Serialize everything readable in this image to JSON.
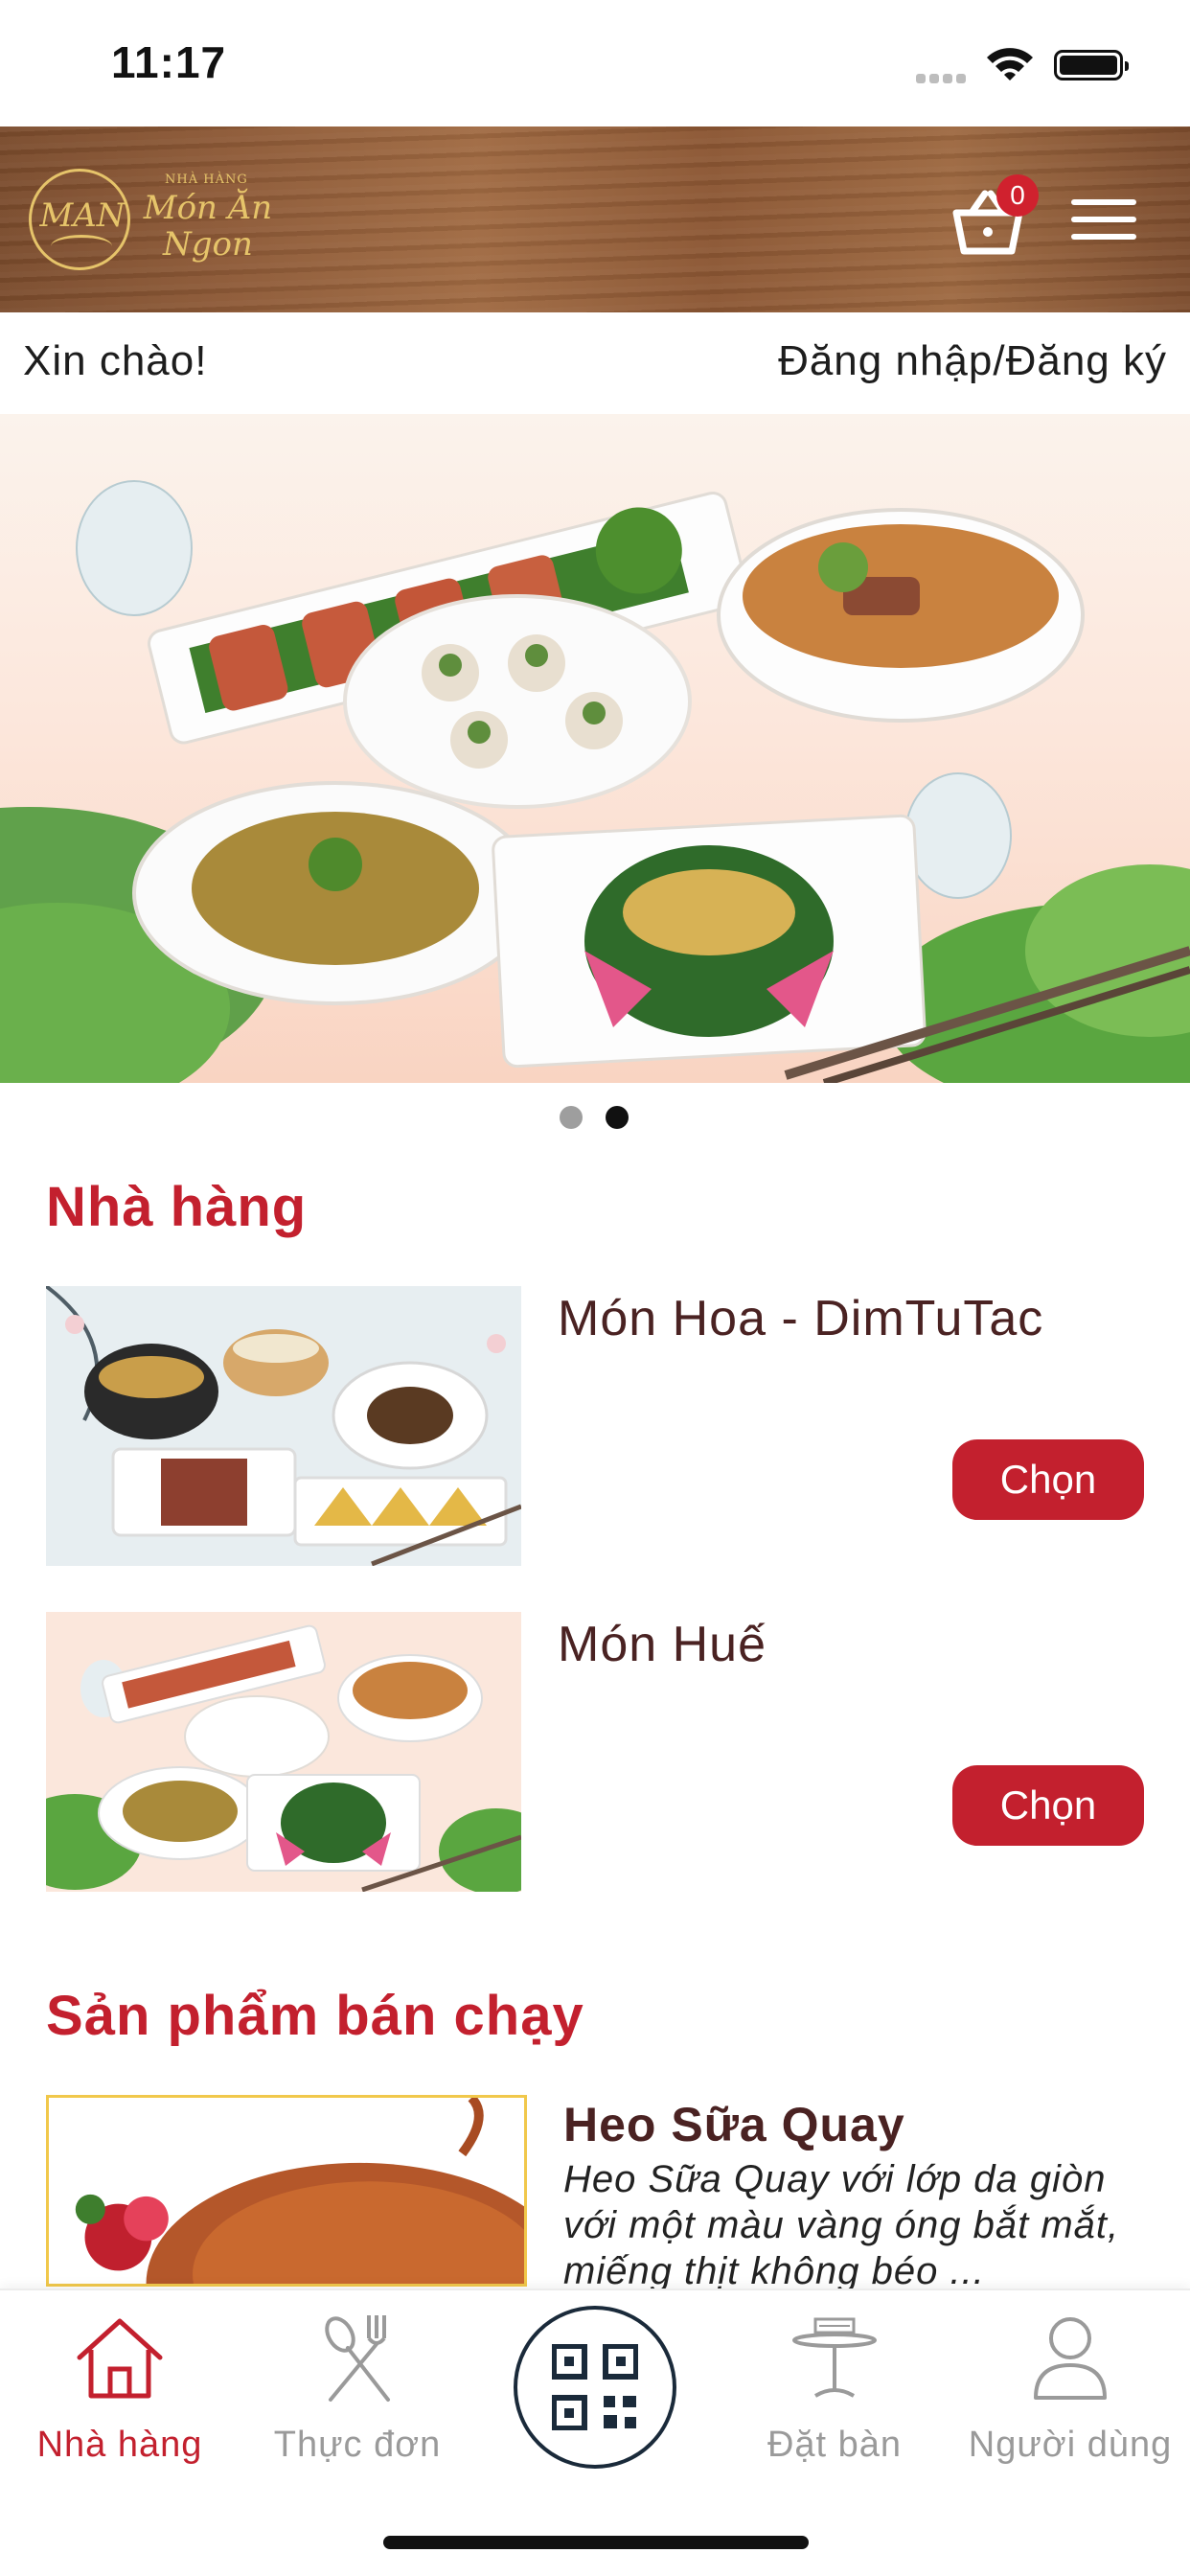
{
  "status_bar": {
    "time": "11:17"
  },
  "header": {
    "logo": {
      "mark": "MAN",
      "small_text": "NHÀ HÀNG",
      "name_line1": "Món Ăn",
      "name_line2": "Ngon"
    },
    "cart_count": "0",
    "colors": {
      "header_wood": "#8e5a37",
      "logo_gold": "#e6c46a",
      "badge": "#d0212e"
    }
  },
  "greeting": {
    "hello": "Xin chào!",
    "login": "Đăng nhập/Đăng ký"
  },
  "banner": {
    "active_slide": 2,
    "total_slides": 2
  },
  "restaurants": {
    "title": "Nhà hàng",
    "items": [
      {
        "name": "Món Hoa - DimTuTac",
        "button": "Chọn"
      },
      {
        "name": "Món Huế",
        "button": "Chọn"
      }
    ]
  },
  "best_sellers": {
    "title": "Sản phẩm bán chạy",
    "items": [
      {
        "name": "Heo Sữa Quay",
        "description": "Heo Sữa Quay với lớp da giòn với một màu vàng óng bắt mắt, miếng thịt không béo ..."
      }
    ]
  },
  "bottom_nav": {
    "items": [
      {
        "label": "Nhà hàng",
        "icon": "home-icon",
        "active": true
      },
      {
        "label": "Thực đơn",
        "icon": "utensils-icon",
        "active": false
      },
      {
        "label": "",
        "icon": "qr-code-icon",
        "active": false
      },
      {
        "label": "Đặt bàn",
        "icon": "reserved-table-icon",
        "active": false
      },
      {
        "label": "Người dùng",
        "icon": "user-icon",
        "active": false
      }
    ]
  },
  "theme": {
    "accent": "#c3202e",
    "text_dark": "#4a2222",
    "inactive": "#9a9a9a"
  }
}
